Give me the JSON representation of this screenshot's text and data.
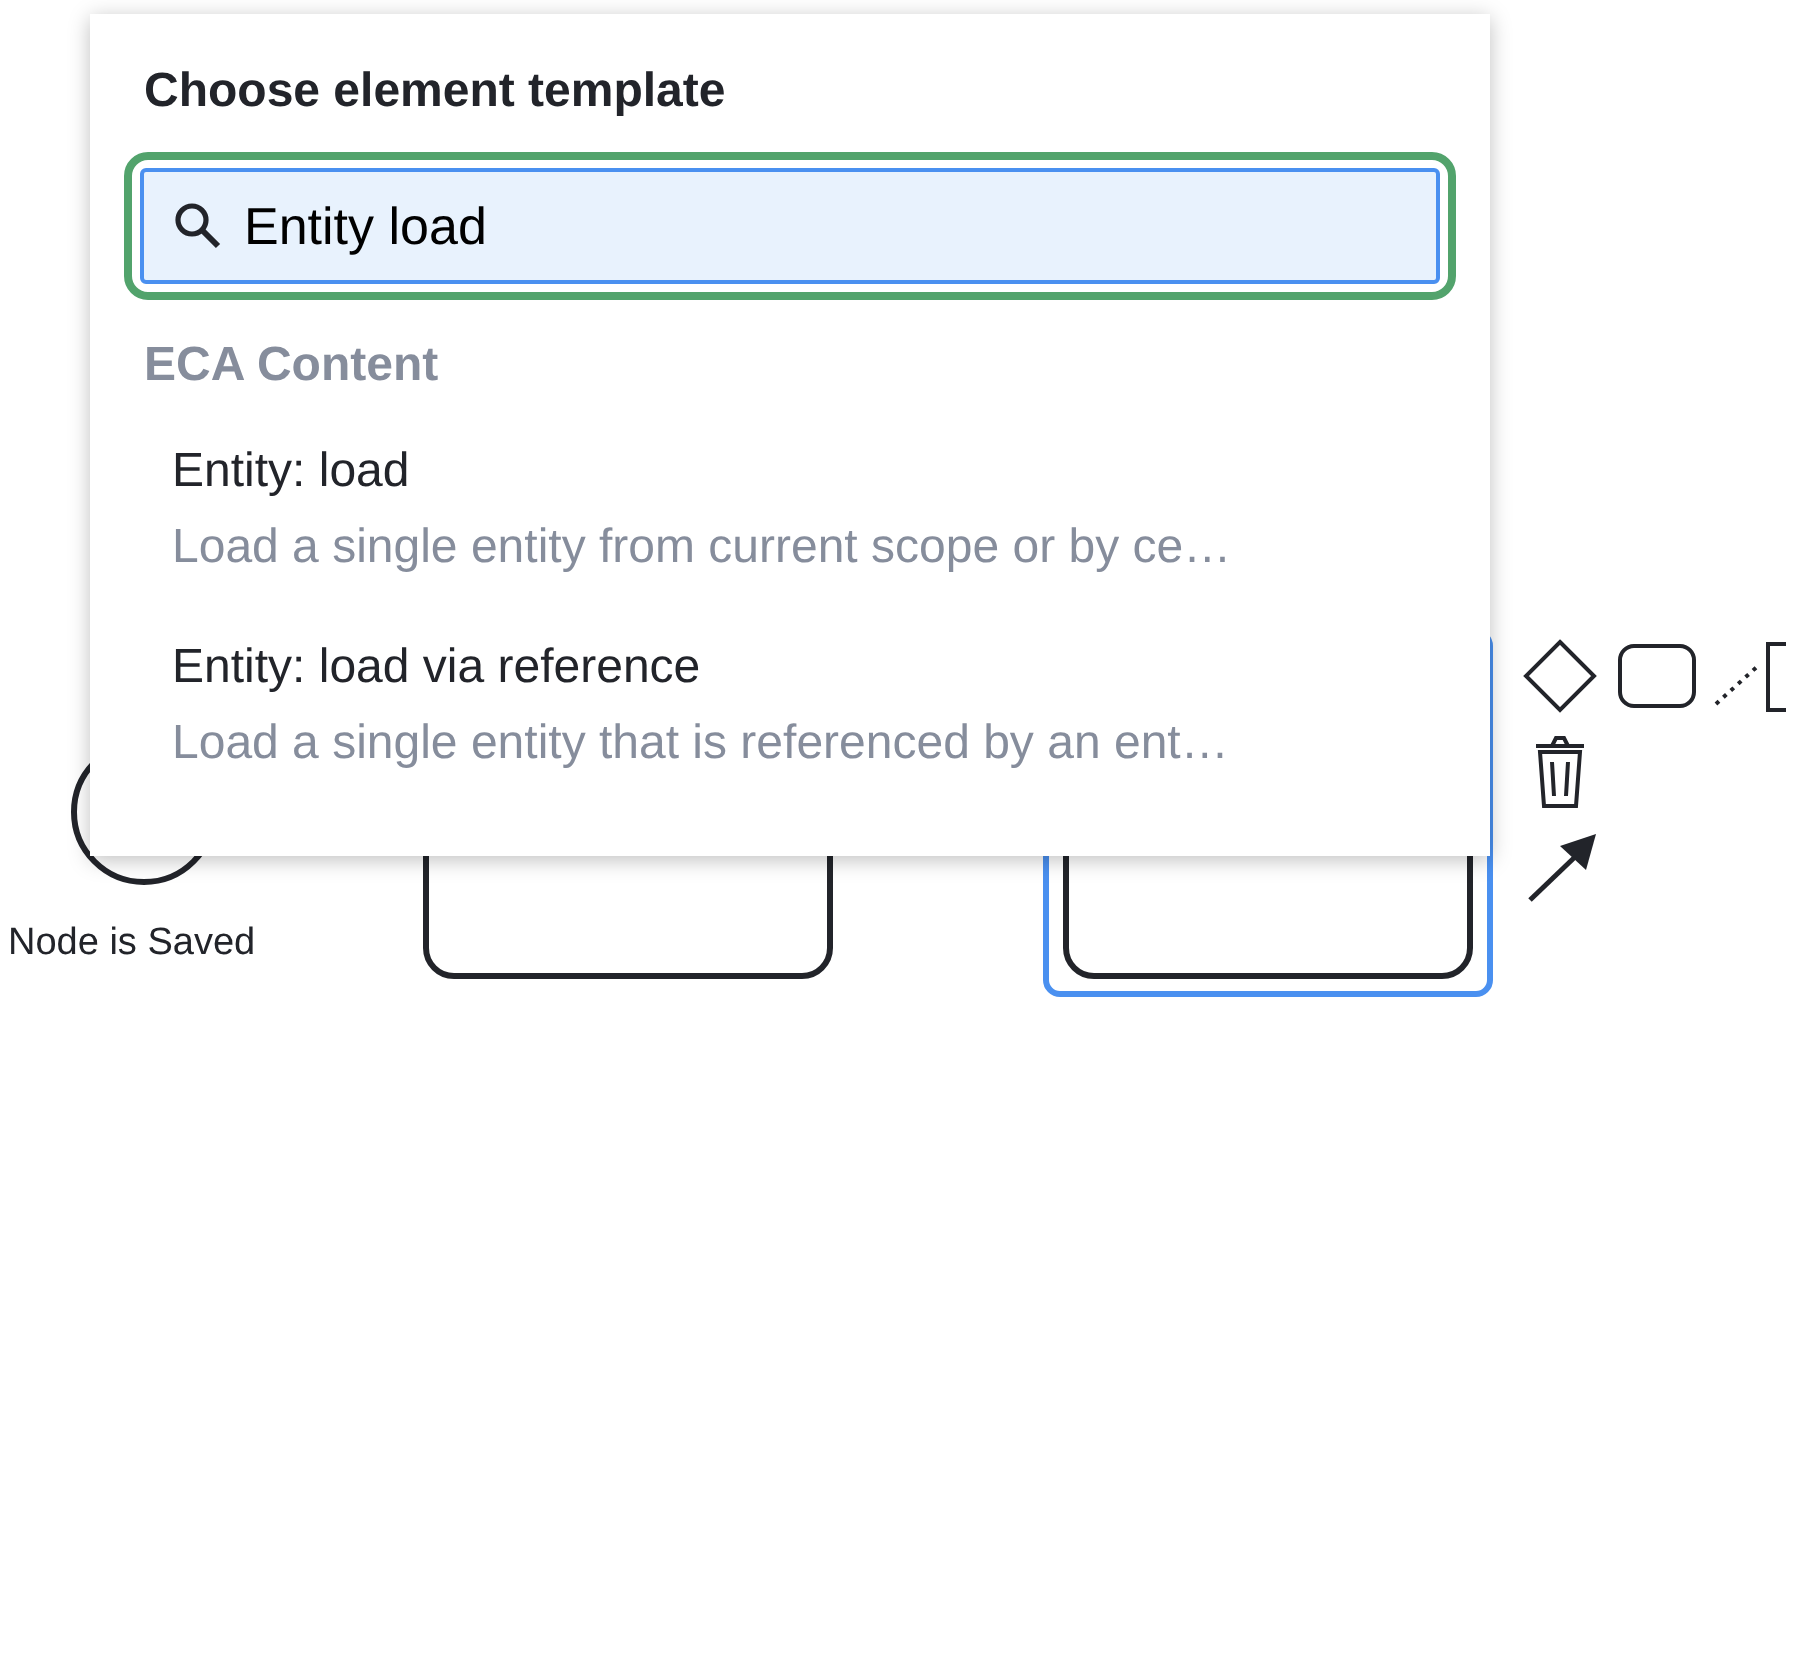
{
  "canvas": {
    "elements": [
      {
        "kind": "start-event",
        "label": "Node is Saved"
      },
      {
        "kind": "task",
        "selected": false
      },
      {
        "kind": "task",
        "selected": true
      }
    ]
  },
  "popup": {
    "title": "Choose element template",
    "search": {
      "value": "Entity load"
    },
    "groups": [
      {
        "heading": "ECA Content",
        "items": [
          {
            "title": "Entity: load",
            "description": "Load a single entity from current scope or by ce…"
          },
          {
            "title": "Entity: load via reference",
            "description": "Load a single entity that is referenced by an ent…"
          }
        ]
      }
    ]
  }
}
